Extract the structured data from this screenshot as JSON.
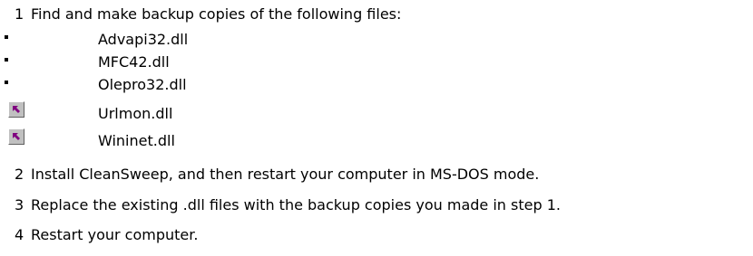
{
  "steps": [
    {
      "num": "1",
      "text": "Find and make backup copies of the following files:"
    },
    {
      "num": "2",
      "text": "Install CleanSweep, and then restart your computer in MS-DOS mode."
    },
    {
      "num": "3",
      "text": "Replace the existing .dll files with the backup copies you made in step 1."
    },
    {
      "num": "4",
      "text": "Restart your computer."
    }
  ],
  "files": [
    {
      "name": "Advapi32.dll",
      "marker": "bullet"
    },
    {
      "name": "MFC42.dll",
      "marker": "bullet"
    },
    {
      "name": "Olepro32.dll",
      "marker": "bullet"
    },
    {
      "name": "Urlmon.dll",
      "marker": "shortcut-arrow-icon"
    },
    {
      "name": "Wininet.dll",
      "marker": "shortcut-arrow-icon"
    }
  ],
  "colors": {
    "shortcut_arrow": "#800080",
    "icon_face": "#c0c0c0"
  }
}
